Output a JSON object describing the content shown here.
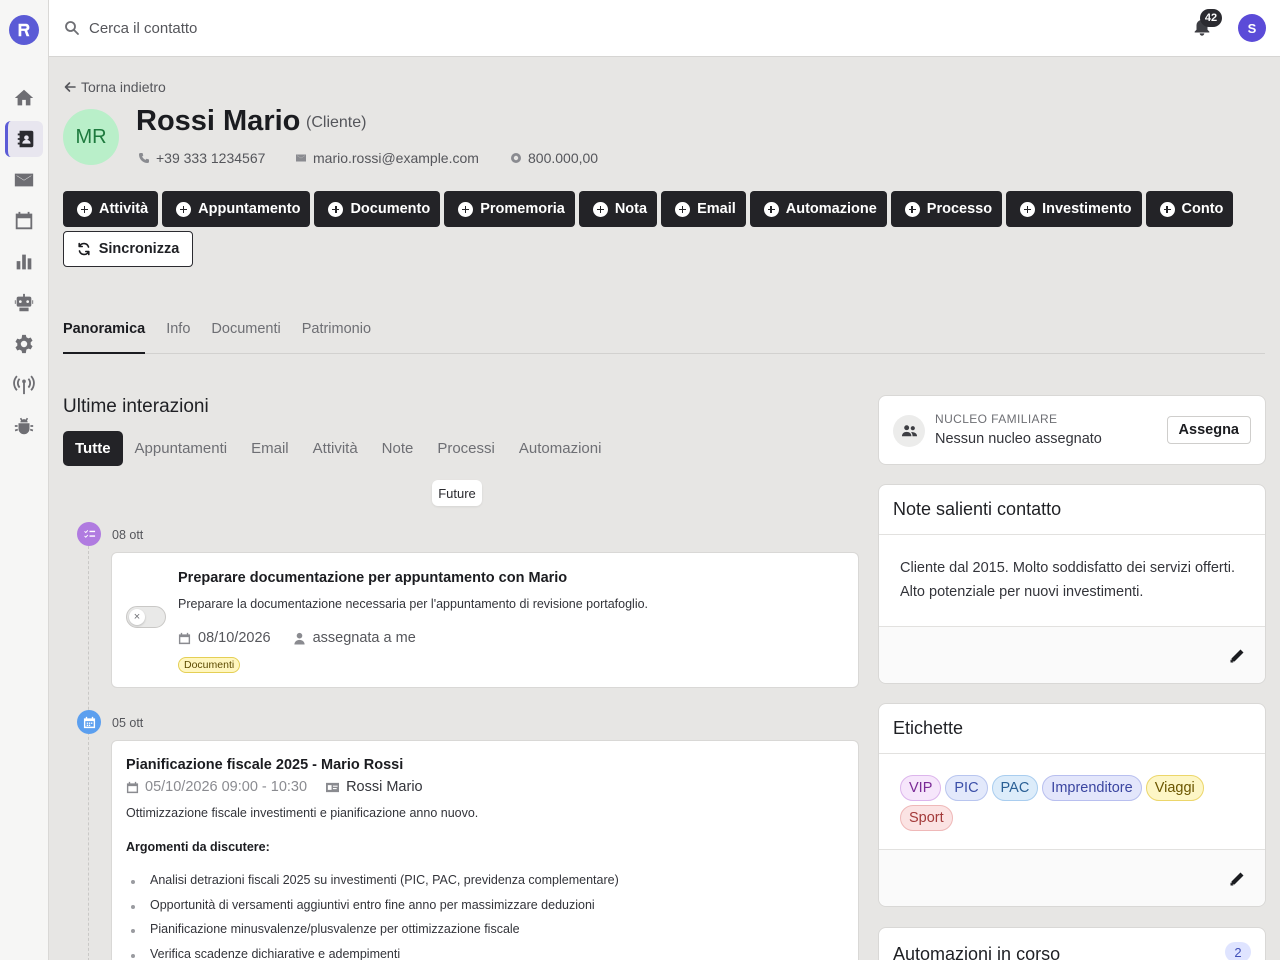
{
  "sidebar": {
    "items": [
      {
        "name": "home"
      },
      {
        "name": "contacts"
      },
      {
        "name": "mail"
      },
      {
        "name": "calendar"
      },
      {
        "name": "reports"
      },
      {
        "name": "robot"
      },
      {
        "name": "settings"
      },
      {
        "name": "antenna"
      },
      {
        "name": "bug"
      }
    ]
  },
  "topbar": {
    "search_placeholder": "Cerca il contatto",
    "notifications_count": "42",
    "user_initial": "S"
  },
  "header": {
    "back_label": "Torna indietro",
    "initials": "MR",
    "name": "Rossi Mario",
    "type": "(Cliente)",
    "phone": "+39 333 1234567",
    "email": "mario.rossi@example.com",
    "wealth": "800.000,00"
  },
  "actions": [
    "Attività",
    "Appuntamento",
    "Documento",
    "Promemoria",
    "Nota",
    "Email",
    "Automazione",
    "Processo",
    "Investimento",
    "Conto"
  ],
  "sync_label": "Sincronizza",
  "tabs": [
    "Panoramica",
    "Info",
    "Documenti",
    "Patrimonio"
  ],
  "interactions": {
    "title": "Ultime interazioni",
    "filters": [
      "Tutte",
      "Appuntamenti",
      "Email",
      "Attività",
      "Note",
      "Processi",
      "Automazioni"
    ],
    "future_label": "Future",
    "task": {
      "date": "08 ott",
      "title": "Preparare documentazione per appuntamento con Mario",
      "description": "Preparare la documentazione necessaria per l'appuntamento di revisione portafoglio.",
      "due": "08/10/2026",
      "assignee": "assegnata a me",
      "tag": "Documenti"
    },
    "appointment": {
      "date": "05 ott",
      "title": "Pianificazione fiscale 2025 - Mario Rossi",
      "when": "05/10/2026 09:00 - 10:30",
      "contact": "Rossi Mario",
      "description": "Ottimizzazione fiscale investimenti e pianificazione anno nuovo.",
      "subtitle": "Argomenti da discutere:",
      "items": [
        "Analisi detrazioni fiscali 2025 su investimenti (PIC, PAC, previdenza complementare)",
        "Opportunità di versamenti aggiuntivi entro fine anno per massimizzare deduzioni",
        "Pianificazione minusvalenze/plusvalenze per ottimizzazione fiscale",
        "Verifica scadenze dichiarative e adempimenti"
      ]
    }
  },
  "family": {
    "label": "NUCLEO FAMILIARE",
    "value": "Nessun nucleo assegnato",
    "assign_label": "Assegna"
  },
  "notes": {
    "title": "Note salienti contatto",
    "text": "Cliente dal 2015. Molto soddisfatto dei servizi offerti. Alto potenziale per nuovi investimenti."
  },
  "labels": {
    "title": "Etichette",
    "tags": [
      {
        "text": "VIP",
        "bg": "#f6e6fb",
        "border": "#dcb5ec",
        "color": "#7a2a96"
      },
      {
        "text": "PIC",
        "bg": "#e3e9fb",
        "border": "#b8c5ef",
        "color": "#3b4fa8"
      },
      {
        "text": "PAC",
        "bg": "#dcecfa",
        "border": "#a9cdef",
        "color": "#2a5f95"
      },
      {
        "text": "Imprenditore",
        "bg": "#e3e6fb",
        "border": "#b8bfef",
        "color": "#3a45a0"
      },
      {
        "text": "Viaggi",
        "bg": "#fdf6c6",
        "border": "#ecd66a",
        "color": "#6b5600"
      },
      {
        "text": "Sport",
        "bg": "#fbe3e3",
        "border": "#efb8b8",
        "color": "#a33a3a"
      }
    ]
  },
  "automations": {
    "title": "Automazioni in corso",
    "count": "2"
  }
}
